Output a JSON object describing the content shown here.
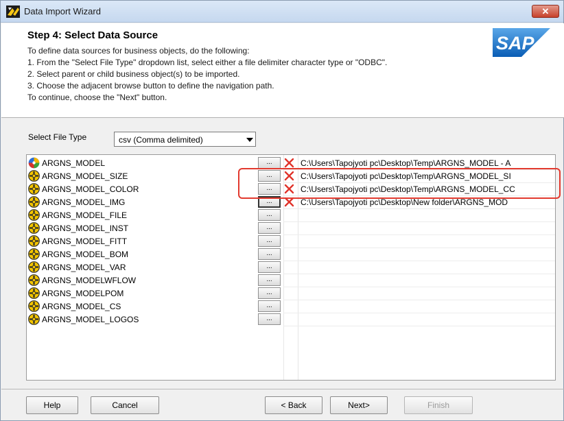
{
  "window": {
    "title": "Data Import Wizard",
    "close_glyph": "✕"
  },
  "header": {
    "step_title": "Step 4: Select Data Source",
    "instructions": [
      "To define data sources for business objects, do the following:",
      "1. From the \"Select File Type\" dropdown list, select either a file delimiter character type or \"ODBC\".",
      "2. Select parent or child business object(s) to be imported.",
      "3. Choose the adjacent browse button to define the navigation path.",
      "To continue, choose the \"Next\" button."
    ],
    "logo_text": "SAP"
  },
  "file_type": {
    "label": "Select File Type",
    "selected": "csv (Comma delimited)"
  },
  "objects": [
    {
      "name": "ARGNS_MODEL",
      "icon": "parent-object-icon",
      "browse_label": "...",
      "path": "C:\\Users\\Tapojyoti pc\\Desktop\\Temp\\ARGNS_MODEL - A",
      "has_path": true
    },
    {
      "name": "ARGNS_MODEL_SIZE",
      "icon": "child-object-icon",
      "browse_label": "...",
      "path": "C:\\Users\\Tapojyoti pc\\Desktop\\Temp\\ARGNS_MODEL_SI",
      "has_path": true
    },
    {
      "name": "ARGNS_MODEL_COLOR",
      "icon": "child-object-icon",
      "browse_label": "...",
      "path": "C:\\Users\\Tapojyoti pc\\Desktop\\Temp\\ARGNS_MODEL_CC",
      "has_path": true
    },
    {
      "name": "ARGNS_MODEL_IMG",
      "icon": "child-object-icon",
      "browse_label": "...",
      "path": "C:\\Users\\Tapojyoti pc\\Desktop\\New folder\\ARGNS_MOD",
      "has_path": true
    },
    {
      "name": "ARGNS_MODEL_FILE",
      "icon": "child-object-icon",
      "browse_label": "...",
      "path": "",
      "has_path": false
    },
    {
      "name": "ARGNS_MODEL_INST",
      "icon": "child-object-icon",
      "browse_label": "...",
      "path": "",
      "has_path": false
    },
    {
      "name": "ARGNS_MODEL_FITT",
      "icon": "child-object-icon",
      "browse_label": "...",
      "path": "",
      "has_path": false
    },
    {
      "name": "ARGNS_MODEL_BOM",
      "icon": "child-object-icon",
      "browse_label": "...",
      "path": "",
      "has_path": false
    },
    {
      "name": "ARGNS_MODEL_VAR",
      "icon": "child-object-icon",
      "browse_label": "...",
      "path": "",
      "has_path": false
    },
    {
      "name": "ARGNS_MODELWFLOW",
      "icon": "child-object-icon",
      "browse_label": "...",
      "path": "",
      "has_path": false
    },
    {
      "name": "ARGNS_MODELPOM",
      "icon": "child-object-icon",
      "browse_label": "...",
      "path": "",
      "has_path": false
    },
    {
      "name": "ARGNS_MODEL_CS",
      "icon": "child-object-icon",
      "browse_label": "...",
      "path": "",
      "has_path": false
    },
    {
      "name": "ARGNS_MODEL_LOGOS",
      "icon": "child-object-icon",
      "browse_label": "...",
      "path": "",
      "has_path": false
    }
  ],
  "buttons": {
    "help": "Help",
    "cancel": "Cancel",
    "back": "< Back",
    "next": "Next>",
    "finish": "Finish"
  },
  "colors": {
    "highlight": "#e2392e",
    "delete_icon": "#e0332a",
    "parent_icon": [
      "#2e6fd8",
      "#f2b400",
      "#3aa33a",
      "#d8332a"
    ],
    "child_icon": [
      "#f2c400",
      "#2b2b2b"
    ],
    "disabled_text": "#9a9a9a"
  }
}
